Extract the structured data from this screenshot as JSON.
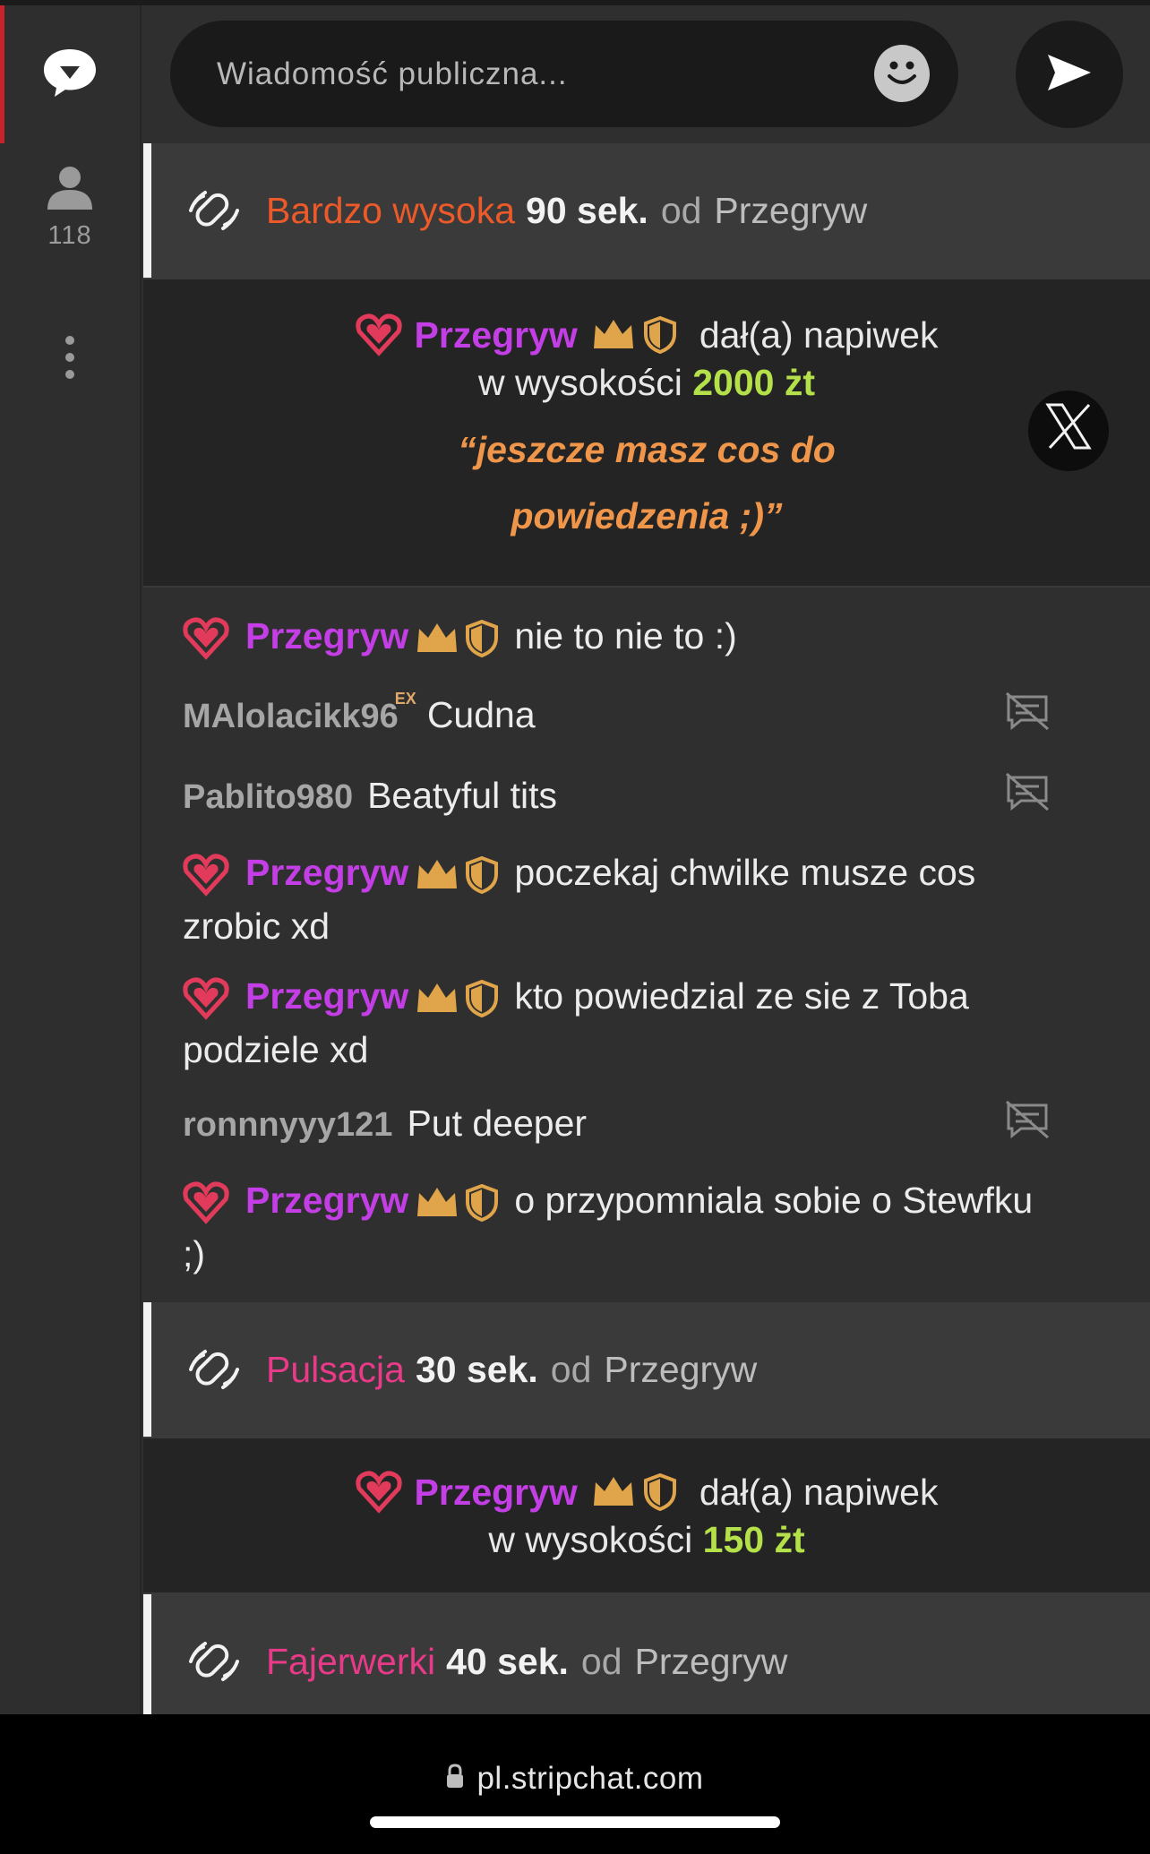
{
  "colors": {
    "accent_red": "#c8232c",
    "username_purple": "#c43ee6",
    "amount_green": "#b4e04a",
    "quote_orange": "#f0964a",
    "action_orange": "#ec5a2a",
    "action_pink": "#e83a88",
    "badge_gold": "#e0a44a",
    "heart_red": "#e23a5a"
  },
  "sidebar": {
    "chat_icon": "chat-bubble-icon",
    "users_icon": "user-icon",
    "users_count": "118",
    "more_icon": "more-vertical-icon"
  },
  "header": {
    "input_placeholder": "Wiadomość publiczna...",
    "emoji_icon": "smiley-icon",
    "send_icon": "send-arrow-icon"
  },
  "feed": {
    "action1": {
      "name": "Bardzo wysoka",
      "duration": "90 sek.",
      "from": "od",
      "user": "Przegryw"
    },
    "tip1": {
      "user": "Przegryw",
      "text1": "dał(a) napiwek",
      "text2": "w wysokości",
      "amount": "2000 żt",
      "quote_line1": "“jeszcze masz cos do",
      "quote_line2": "powiedzenia ;)”",
      "close_icon": "x-close-icon"
    },
    "messages": [
      {
        "user": "Przegryw",
        "text": "nie to nie to :)"
      },
      {
        "user": "MAlolacikk96",
        "tag": "EX",
        "text": "Cudna"
      },
      {
        "user": "Pablito980",
        "text": "Beatyful tits"
      },
      {
        "user": "Przegryw",
        "text": "poczekaj chwilke musze cos zrobic xd"
      },
      {
        "user": "Przegryw",
        "text": "kto powiedzial ze sie z Toba podziele xd"
      },
      {
        "user": "ronnnyyy121",
        "text": "Put deeper"
      },
      {
        "user": "Przegryw",
        "text": "o przypomniala sobie o Stewfku ;)"
      }
    ],
    "action2": {
      "name": "Pulsacja",
      "duration": "30 sek.",
      "from": "od",
      "user": "Przegryw"
    },
    "tip2": {
      "user": "Przegryw",
      "text1": "dał(a) napiwek",
      "text2": "w wysokości",
      "amount": "150 żt"
    },
    "action3": {
      "name": "Fajerwerki",
      "duration": "40 sek.",
      "from": "od",
      "user": "Przegryw"
    }
  },
  "browser": {
    "url": "pl.stripchat.com",
    "lock_icon": "lock-icon"
  }
}
